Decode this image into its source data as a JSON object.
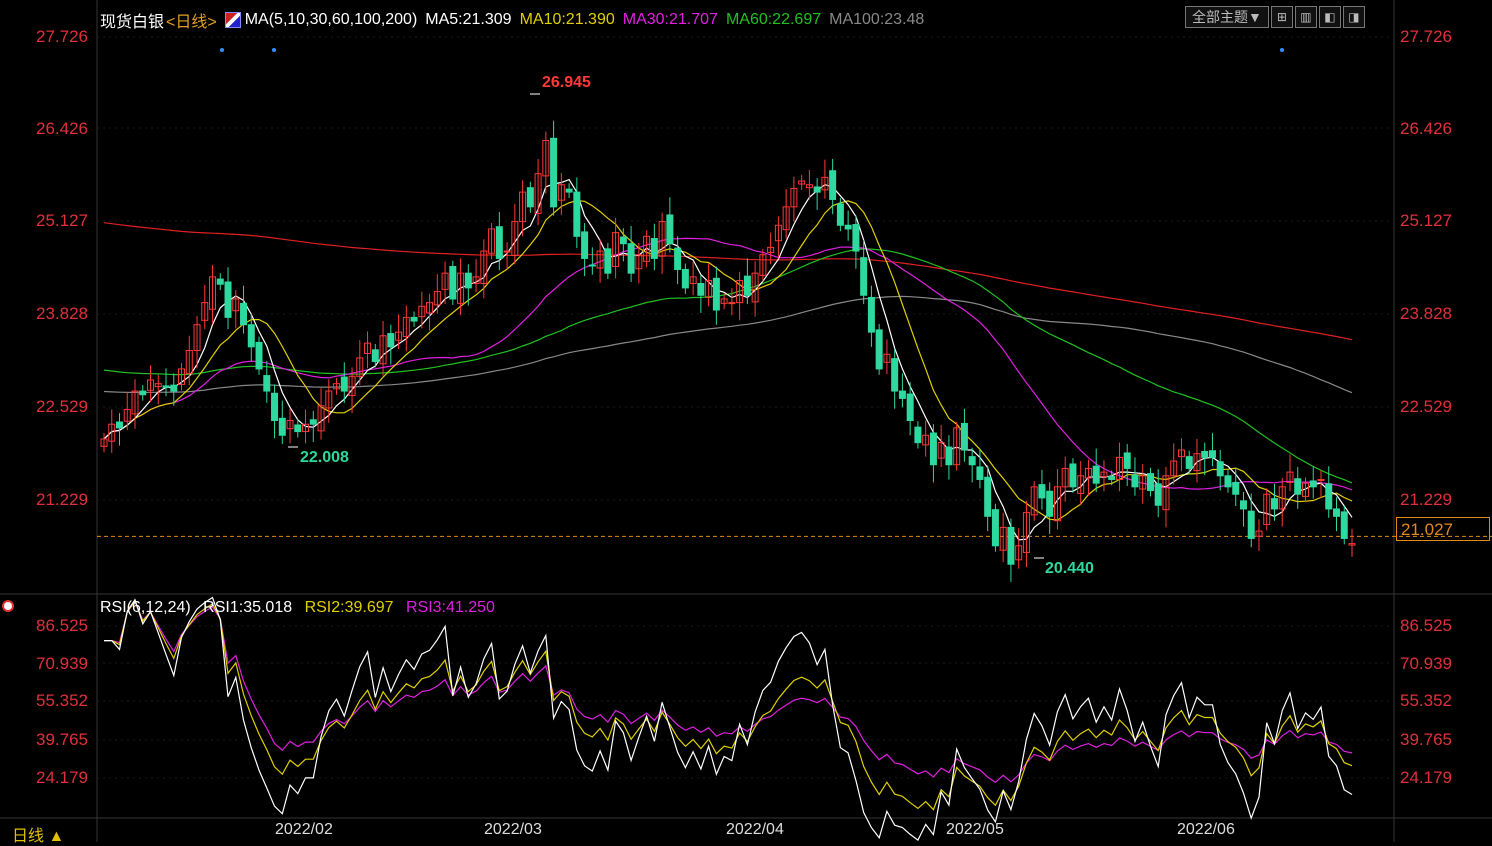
{
  "header": {
    "instrument": "现货白银",
    "period_label": "<日线>",
    "ma_params": "MA(5,10,30,60,100,200)",
    "ma5": "MA5:21.309",
    "ma10": "MA10:21.390",
    "ma30": "MA30:21.707",
    "ma60": "MA60:22.697",
    "ma100": "MA100:23.48"
  },
  "toolbar": {
    "theme_label": "全部主题▼",
    "icons": [
      "grid-icon",
      "layout-icon",
      "panel-icon",
      "split-icon"
    ]
  },
  "rsi_header": {
    "params": "RSI(6,12,24)",
    "rsi1": "RSI1:35.018",
    "rsi2": "RSI2:39.697",
    "rsi3": "RSI3:41.250"
  },
  "price_axis": [
    "27.726",
    "26.426",
    "25.127",
    "23.828",
    "22.529",
    "21.229"
  ],
  "rsi_axis": [
    "86.525",
    "70.939",
    "55.352",
    "39.765",
    "24.179"
  ],
  "x_axis": [
    "2022/02",
    "2022/03",
    "2022/04",
    "2022/05",
    "2022/06"
  ],
  "annotations": {
    "high": "26.945",
    "low_feb": "22.008",
    "low_may": "20.440",
    "current_price": "21.027"
  },
  "footer": {
    "period_button": "日线 ▲"
  },
  "colors": {
    "up": "#ff3838",
    "down": "#2ed9a0",
    "ma5": "#ffffff",
    "ma10": "#e0d000",
    "ma30": "#e020e0",
    "ma60": "#20c020",
    "ma100": "#888888",
    "ma200": "#e02020",
    "rsi1": "#ffffff",
    "rsi2": "#e0d000",
    "rsi3": "#e020e0"
  },
  "chart_data": {
    "type": "candlestick",
    "y_range": [
      20.3,
      27.9
    ],
    "rsi_range": [
      18,
      90
    ],
    "closes": [
      22.35,
      22.55,
      22.5,
      22.75,
      23.0,
      22.95,
      23.15,
      23.1,
      23.05,
      23.0,
      23.3,
      23.55,
      23.9,
      24.2,
      24.55,
      24.45,
      24.0,
      24.25,
      23.9,
      23.6,
      23.3,
      23.0,
      22.6,
      22.4,
      22.6,
      22.45,
      22.55,
      22.55,
      22.8,
      23.0,
      23.1,
      23.0,
      23.2,
      23.45,
      23.65,
      23.4,
      23.75,
      23.6,
      23.8,
      24.0,
      23.95,
      24.15,
      24.2,
      24.35,
      24.6,
      24.25,
      24.6,
      24.4,
      24.55,
      24.9,
      25.2,
      24.8,
      24.9,
      25.3,
      25.7,
      25.5,
      25.95,
      26.4,
      25.5,
      25.8,
      25.7,
      25.1,
      24.8,
      24.7,
      24.9,
      24.6,
      25.15,
      25.0,
      24.6,
      24.85,
      25.1,
      24.8,
      25.3,
      25.0,
      24.65,
      24.4,
      24.55,
      24.3,
      24.5,
      24.1,
      24.25,
      24.2,
      24.5,
      24.3,
      24.6,
      24.85,
      24.95,
      25.25,
      25.5,
      25.75,
      25.85,
      25.8,
      25.7,
      25.9,
      25.6,
      25.25,
      25.2,
      24.9,
      24.3,
      23.8,
      23.3,
      23.5,
      23.0,
      22.9,
      22.6,
      22.3,
      22.4,
      22.0,
      22.3,
      22.0,
      22.5,
      22.2,
      22.0,
      21.8,
      21.3,
      20.9,
      21.15,
      20.65,
      20.9,
      21.35,
      21.7,
      21.55,
      21.3,
      21.7,
      21.95,
      21.7,
      21.85,
      21.95,
      21.75,
      21.9,
      21.8,
      22.1,
      21.95,
      21.7,
      21.85,
      21.65,
      21.45,
      21.85,
      22.05,
      22.2,
      21.95,
      22.15,
      22.1,
      22.1,
      21.85,
      21.7,
      21.6,
      21.4,
      21.0,
      21.1,
      21.6,
      21.4,
      21.7,
      21.9,
      21.6,
      21.75,
      21.7,
      21.8,
      21.4,
      21.3,
      21.0,
      20.93
    ],
    "extremes": {
      "high": 26.945,
      "low_feb": 22.008,
      "low_may": 20.44
    },
    "last_price": 21.027
  }
}
